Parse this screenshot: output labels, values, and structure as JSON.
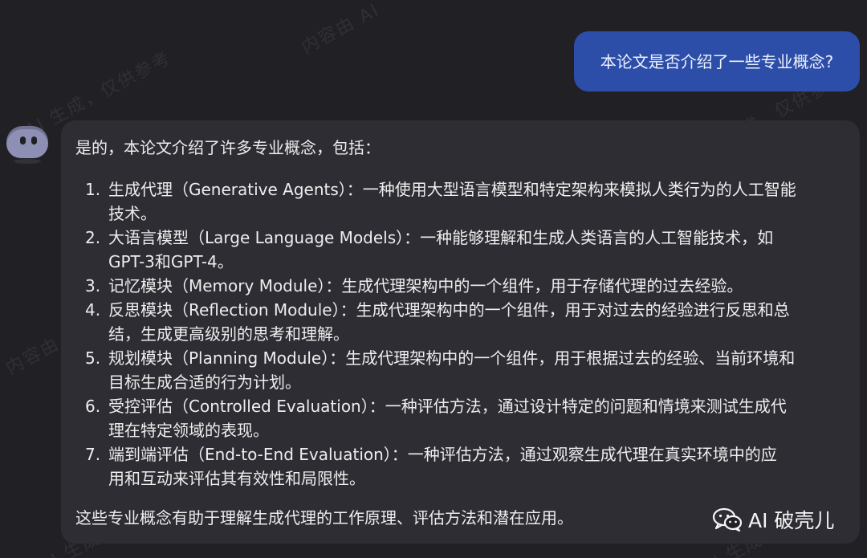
{
  "watermark": {
    "text_1": "内容由 AI",
    "text_2": "AI 生成，仅供参考",
    "text_3": "AI 生成，仅供参考",
    "text_4": "内容由 AI 生",
    "text_5": "AI 生成",
    "text_6": "AI 生成"
  },
  "chat": {
    "user_message": "本论文是否介绍了一些专业概念?",
    "assistant": {
      "intro": "是的，本论文介绍了许多专业概念，包括：",
      "items": [
        {
          "number": "1.",
          "line_1": "生成代理（Generative Agents）：一种使用大型语言模型和特定架构来模拟人类行为的人工智能",
          "line_2": "技术。"
        },
        {
          "number": "2.",
          "line_1": "大语言模型（Large Language Models）：一种能够理解和生成人类语言的人工智能技术，如",
          "line_2": "GPT-3和GPT-4。"
        },
        {
          "number": "3.",
          "line_1": "记忆模块（Memory Module）：生成代理架构中的一个组件，用于存储代理的过去经验。"
        },
        {
          "number": "4.",
          "line_1": "反思模块（Reflection Module）：生成代理架构中的一个组件，用于对过去的经验进行反思和总",
          "line_2": "结，生成更高级别的思考和理解。"
        },
        {
          "number": "5.",
          "line_1": "规划模块（Planning Module）：生成代理架构中的一个组件，用于根据过去的经验、当前环境和",
          "line_2": "目标生成合适的行为计划。"
        },
        {
          "number": "6.",
          "line_1": "受控评估（Controlled Evaluation）：一种评估方法，通过设计特定的问题和情境来测试生成代",
          "line_2": "理在特定领域的表现。"
        },
        {
          "number": "7.",
          "line_1": "端到端评估（End-to-End Evaluation）：一种评估方法，通过观察生成代理在真实环境中的应",
          "line_2": "用和互动来评估其有效性和局限性。"
        }
      ],
      "outro": "这些专业概念有助于理解生成代理的工作原理、评估方法和潜在应用。"
    }
  },
  "brand": {
    "icon": "wechat-icon",
    "label": "AI 破壳儿"
  },
  "colors": {
    "background": "#202025",
    "user_bubble": "#2d4ea8",
    "assistant_bubble": "#2d2d33",
    "text": "#eeeeef",
    "avatar": "#8d8fb4"
  }
}
